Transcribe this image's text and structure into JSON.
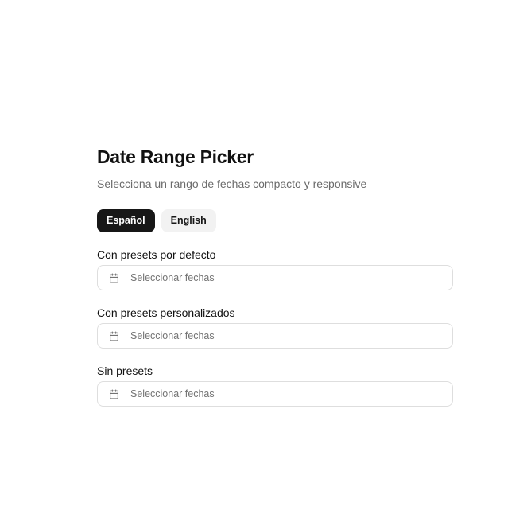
{
  "header": {
    "title": "Date Range Picker",
    "subtitle": "Selecciona un rango de fechas compacto y responsive"
  },
  "language_switch": {
    "options": [
      {
        "label": "Español",
        "active": true
      },
      {
        "label": "English",
        "active": false
      }
    ]
  },
  "fields": [
    {
      "label": "Con presets por defecto",
      "placeholder": "Seleccionar fechas",
      "icon": "calendar-icon"
    },
    {
      "label": "Con presets personalizados",
      "placeholder": "Seleccionar fechas",
      "icon": "calendar-icon"
    },
    {
      "label": "Sin presets",
      "placeholder": "Seleccionar fechas",
      "icon": "calendar-icon"
    }
  ],
  "colors": {
    "active_button_bg": "#171717",
    "inactive_button_bg": "#f2f2f2",
    "border": "#dedede",
    "muted_text": "#737373"
  }
}
